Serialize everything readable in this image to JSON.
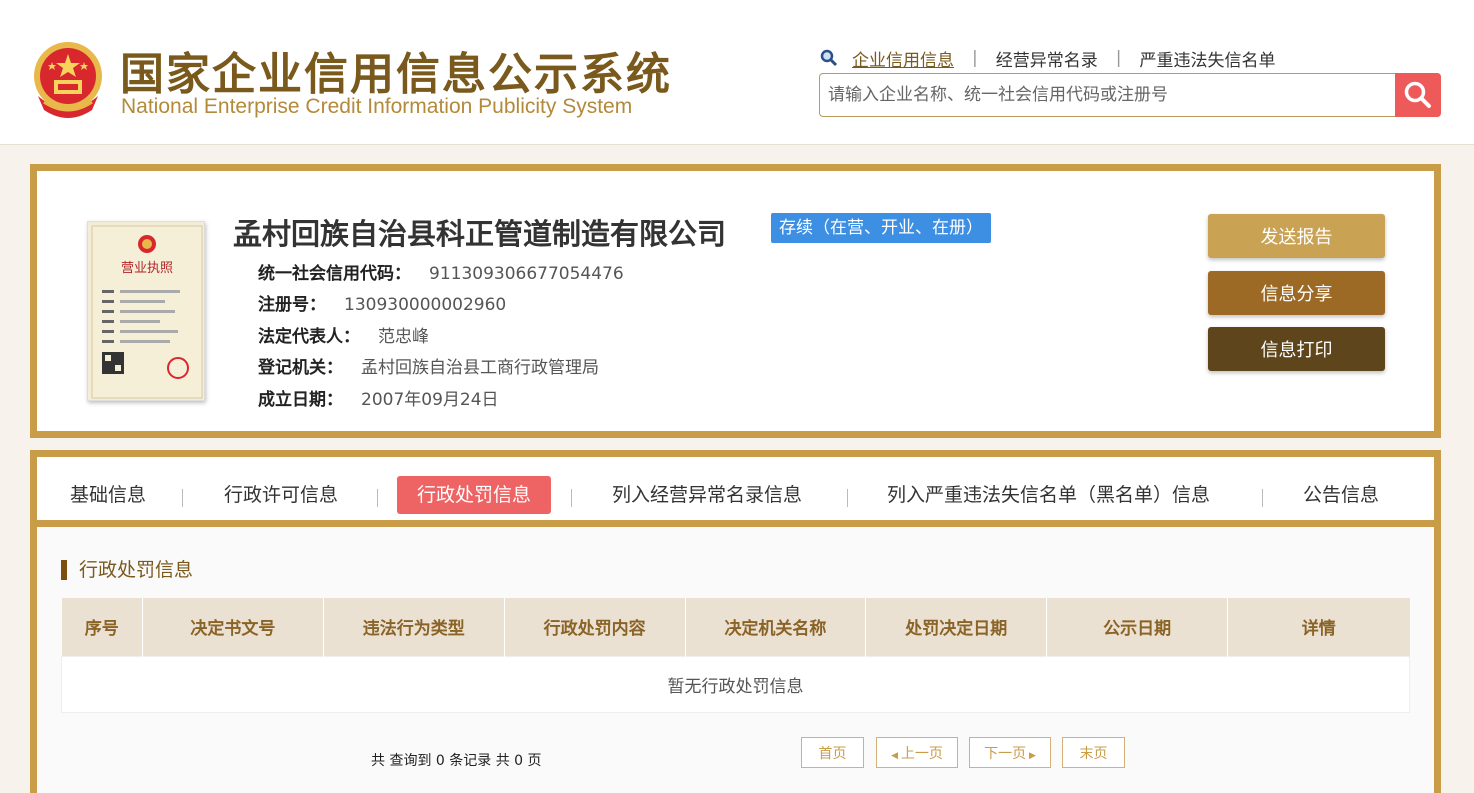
{
  "header": {
    "title_cn": "国家企业信用信息公示系统",
    "title_en": "National Enterprise Credit Information Publicity System",
    "nav": [
      {
        "label": "企业信用信息"
      },
      {
        "label": "经营异常名录"
      },
      {
        "label": "严重违法失信名单"
      }
    ],
    "nav_separator": "|",
    "search": {
      "placeholder": "请输入企业名称、统一社会信用代码或注册号",
      "value": ""
    }
  },
  "company": {
    "name": "孟村回族自治县科正管道制造有限公司",
    "status": "存续（在营、开业、在册）",
    "fields": [
      {
        "label": "统一社会信用代码：",
        "value": "911309306677054476"
      },
      {
        "label": "注册号：",
        "value": "130930000002960"
      },
      {
        "label": "法定代表人：",
        "value": "范忠峰"
      },
      {
        "label": "登记机关：",
        "value": "孟村回族自治县工商行政管理局"
      },
      {
        "label": "成立日期：",
        "value": "2007年09月24日"
      }
    ],
    "actions": {
      "send_report": "发送报告",
      "share": "信息分享",
      "print": "信息打印"
    },
    "license_text": "营业执照"
  },
  "tabs": [
    {
      "label": "基础信息"
    },
    {
      "label": "行政许可信息"
    },
    {
      "label": "行政处罚信息",
      "active": true
    },
    {
      "label": "列入经营异常名录信息"
    },
    {
      "label": "列入严重违法失信名单（黑名单）信息"
    },
    {
      "label": "公告信息"
    }
  ],
  "section": {
    "title": "行政处罚信息",
    "columns": [
      "序号",
      "决定书文号",
      "违法行为类型",
      "行政处罚内容",
      "决定机关名称",
      "处罚决定日期",
      "公示日期",
      "详情"
    ],
    "empty_text": "暂无行政处罚信息"
  },
  "pagination": {
    "summary": "共 查询到 0 条记录 共 0 页",
    "first": "首页",
    "prev": "上一页",
    "next": "下一页",
    "last": "末页"
  },
  "colors": {
    "brand_gold": "#c99c48",
    "brand_brown": "#7a5a1c",
    "active_tab": "#ee6464",
    "status_blue": "#3d8fe3",
    "btn_send": "#c9a254",
    "btn_share": "#9c6a25",
    "btn_print": "#5e451b"
  },
  "icons": {
    "emblem": "national-emblem-icon",
    "search": "search-icon",
    "magnifier": "magnifier-icon"
  }
}
